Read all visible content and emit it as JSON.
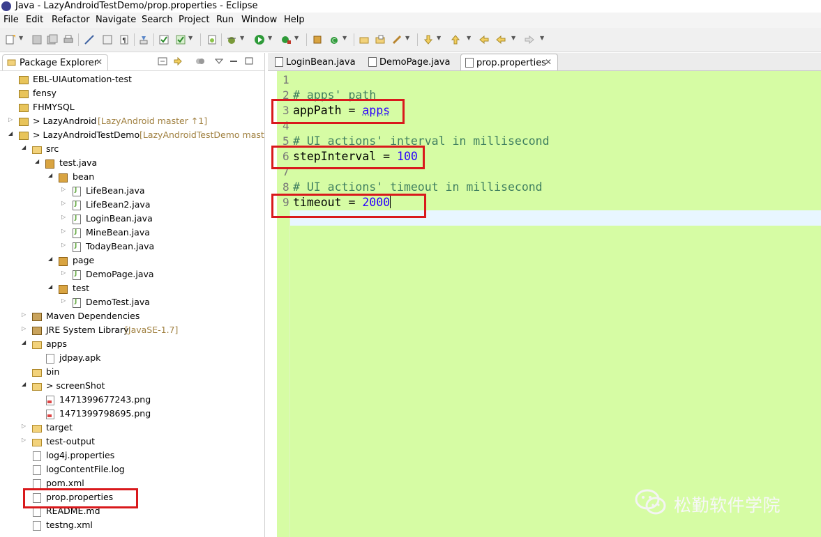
{
  "window": {
    "title": "Java - LazyAndroidTestDemo/prop.properties - Eclipse"
  },
  "menubar": [
    "File",
    "Edit",
    "Refactor",
    "Navigate",
    "Search",
    "Project",
    "Run",
    "Window",
    "Help"
  ],
  "package_explorer": {
    "tab_label": "Package Explorer",
    "items": [
      {
        "label": "EBL-UIAutomation-test",
        "deco": ""
      },
      {
        "label": "fensy",
        "deco": ""
      },
      {
        "label": "FHMYSQL",
        "deco": ""
      },
      {
        "label": "> LazyAndroid",
        "deco": "[LazyAndroid master ↑1]"
      },
      {
        "label": "> LazyAndroidTestDemo",
        "deco": "[LazyAndroidTestDemo master"
      },
      {
        "label": "src",
        "deco": ""
      },
      {
        "label": "test.java",
        "deco": ""
      },
      {
        "label": "bean",
        "deco": ""
      },
      {
        "label": "LifeBean.java",
        "deco": ""
      },
      {
        "label": "LifeBean2.java",
        "deco": ""
      },
      {
        "label": "LoginBean.java",
        "deco": ""
      },
      {
        "label": "MineBean.java",
        "deco": ""
      },
      {
        "label": "TodayBean.java",
        "deco": ""
      },
      {
        "label": "page",
        "deco": ""
      },
      {
        "label": "DemoPage.java",
        "deco": ""
      },
      {
        "label": "test",
        "deco": ""
      },
      {
        "label": "DemoTest.java",
        "deco": ""
      },
      {
        "label": "Maven Dependencies",
        "deco": ""
      },
      {
        "label": "JRE System Library",
        "deco": "[JavaSE-1.7]"
      },
      {
        "label": "apps",
        "deco": ""
      },
      {
        "label": "jdpay.apk",
        "deco": ""
      },
      {
        "label": "bin",
        "deco": ""
      },
      {
        "label": "> screenShot",
        "deco": ""
      },
      {
        "label": "1471399677243.png",
        "deco": ""
      },
      {
        "label": "1471399798695.png",
        "deco": ""
      },
      {
        "label": "target",
        "deco": ""
      },
      {
        "label": "test-output",
        "deco": ""
      },
      {
        "label": "log4j.properties",
        "deco": ""
      },
      {
        "label": "logContentFile.log",
        "deco": ""
      },
      {
        "label": "pom.xml",
        "deco": ""
      },
      {
        "label": "prop.properties",
        "deco": ""
      },
      {
        "label": "README.md",
        "deco": ""
      },
      {
        "label": "testng.xml",
        "deco": ""
      }
    ]
  },
  "editor": {
    "tabs": [
      "LoginBean.java",
      "DemoPage.java",
      "prop.properties"
    ],
    "active_tab": "prop.properties",
    "lines": [
      {
        "num": "1",
        "comment": "",
        "key": "",
        "eq": "",
        "value": ""
      },
      {
        "num": "2",
        "comment": "# apps' path",
        "key": "",
        "eq": "",
        "value": ""
      },
      {
        "num": "3",
        "comment": "",
        "key": "appPath",
        "eq": " = ",
        "value": "apps"
      },
      {
        "num": "4",
        "comment": "",
        "key": "",
        "eq": "",
        "value": ""
      },
      {
        "num": "5",
        "comment": "# UI actions' interval in millisecond",
        "key": "",
        "eq": "",
        "value": ""
      },
      {
        "num": "6",
        "comment": "",
        "key": "stepInterval",
        "eq": " = ",
        "value": "100"
      },
      {
        "num": "7",
        "comment": "",
        "key": "",
        "eq": "",
        "value": ""
      },
      {
        "num": "8",
        "comment": "# UI actions' timeout in millisecond",
        "key": "",
        "eq": "",
        "value": ""
      },
      {
        "num": "9",
        "comment": "",
        "key": "timeout",
        "eq": " = ",
        "value": "2000"
      }
    ]
  },
  "watermark": {
    "text": "松勤软件学院"
  },
  "colors": {
    "editor_bg": "#d6fca4",
    "highlight": "#d9191c",
    "comment": "#3f7f5f",
    "value": "#2a00ff"
  }
}
